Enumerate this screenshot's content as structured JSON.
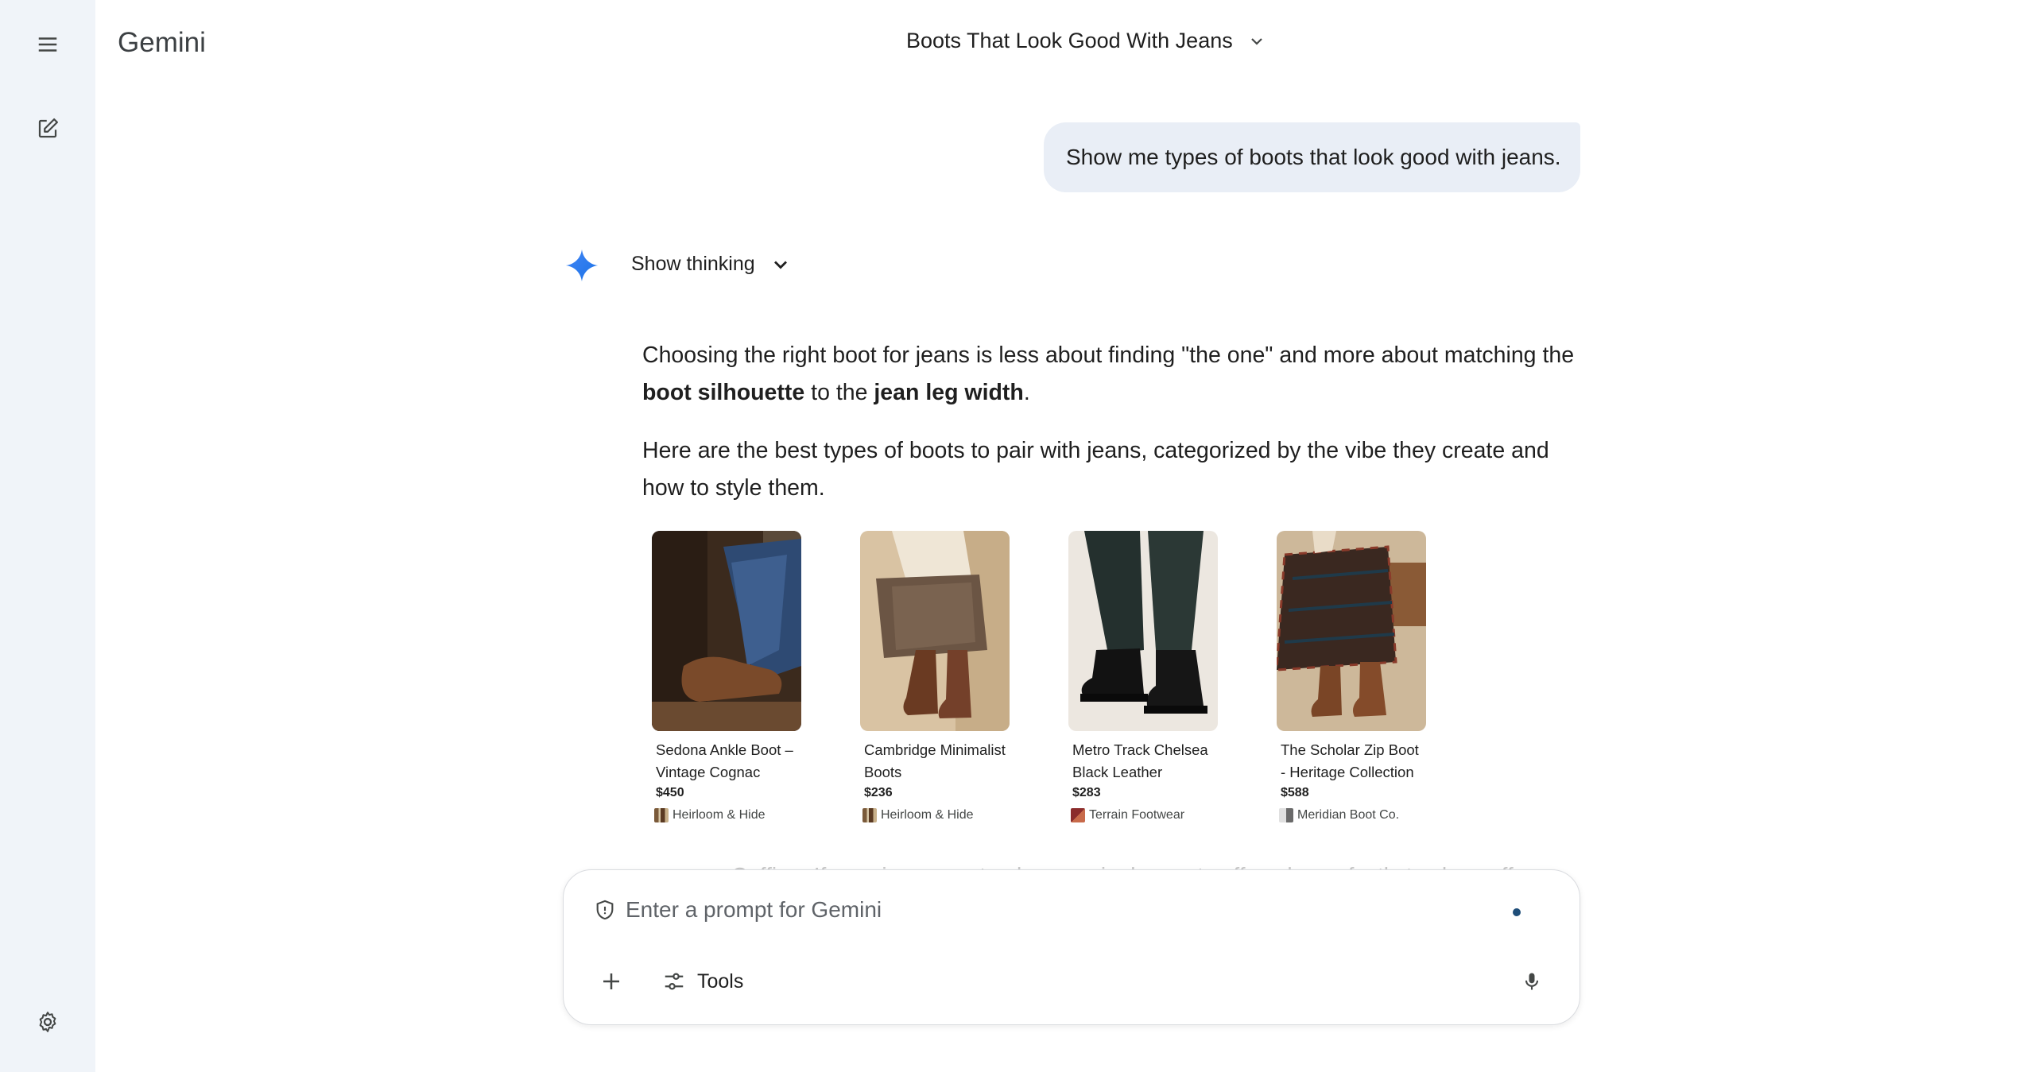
{
  "app": {
    "name": "Gemini"
  },
  "header": {
    "conversation_title": "Boots That Look Good With Jeans"
  },
  "sidebar": {
    "icons": [
      "menu-icon",
      "new-chat-icon",
      "settings-icon"
    ]
  },
  "user_message": "Show me types of boots that look good with jeans.",
  "response": {
    "thinking_label": "Show thinking",
    "p1_part1": "Choosing the right boot for jeans is less about finding \"the one\" and more about matching the ",
    "p1_bold1": "boot silhouette",
    "p1_part2": " to the ",
    "p1_bold2": "jean leg width",
    "p1_part3": ".",
    "p2": "Here are the best types of boots to pair with jeans, categorized by the vibe they create and how to style them."
  },
  "products": [
    {
      "name": "Sedona Ankle Boot – Vintage Cognac",
      "price": "$450",
      "seller": "Heirloom & Hide"
    },
    {
      "name": "Cambridge Minimalist Boots",
      "price": "$236",
      "seller": "Heirloom & Hide"
    },
    {
      "name": "Metro Track Chelsea Black Leather",
      "price": "$283",
      "seller": "Terrain Footwear"
    },
    {
      "name": "The Scholar Zip Boot - Heritage Collection",
      "price": "$588",
      "seller": "Meridian Boot Co."
    }
  ],
  "faded_text": "Cuffing: If your jeans are too long, a single, neat cuff works perfectly to show off",
  "composer": {
    "placeholder": "Enter a prompt for Gemini",
    "tools_label": "Tools"
  },
  "colors": {
    "sidebar_bg": "#f0f4f9",
    "user_bubble_bg": "#e9eef6",
    "spark_blue": "#4285f4"
  }
}
